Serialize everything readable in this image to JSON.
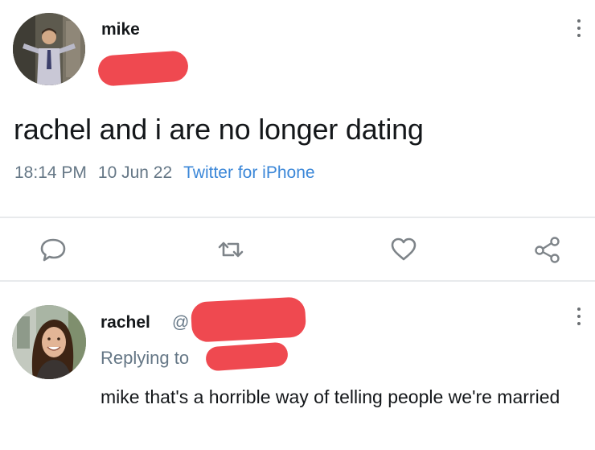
{
  "tweet": {
    "author_name": "mike",
    "text": "rachel and i are no longer dating",
    "time": "18:14 PM",
    "date": "10 Jun 22",
    "source": "Twitter for iPhone",
    "actions": {
      "reply_icon": "reply-icon",
      "retweet_icon": "retweet-icon",
      "like_icon": "heart-icon",
      "share_icon": "share-icon"
    }
  },
  "reply": {
    "author_name": "rachel",
    "handle_prefix": "@",
    "replying_prefix": "Replying to",
    "text": "mike that's a horrible way of telling people we're married"
  },
  "colors": {
    "redaction": "#ef4950",
    "secondary_text": "#657786",
    "link": "#3b87d8",
    "primary_text": "#14171a"
  }
}
